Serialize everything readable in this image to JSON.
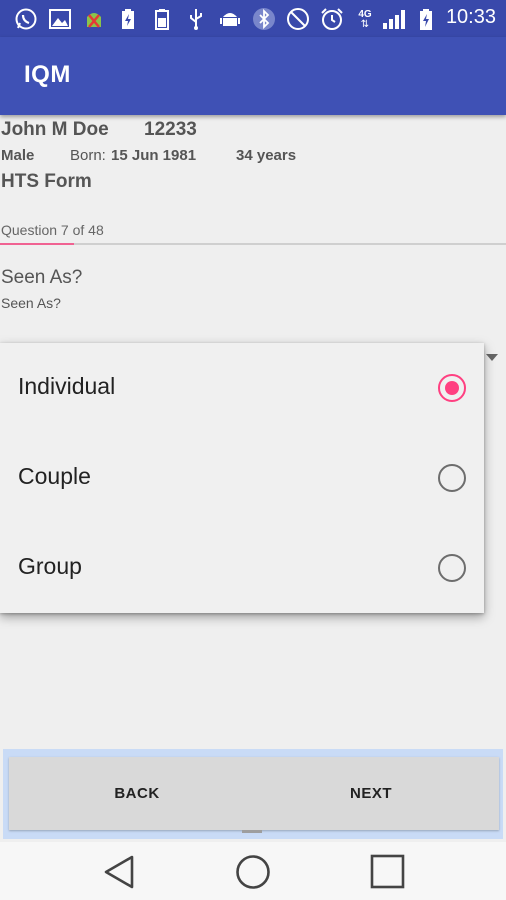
{
  "status_bar": {
    "time": "10:33",
    "icons": [
      "whatsapp-icon",
      "image-icon",
      "android-debug-icon",
      "battery-charging-icon",
      "storage-icon",
      "usb-icon",
      "android-icon",
      "bluetooth-icon",
      "do-not-disturb-icon",
      "alarm-icon",
      "4g-icon",
      "signal-icon",
      "battery-icon"
    ],
    "network_label": "4G"
  },
  "app_bar": {
    "title": "IQM"
  },
  "patient": {
    "name": "John M Doe",
    "id": "12233",
    "gender": "Male",
    "born_label": "Born:",
    "born_date": "15 Jun 1981",
    "age": "34 years"
  },
  "form": {
    "name": "HTS Form"
  },
  "progress": {
    "text": "Question 7 of 48",
    "current": 7,
    "total": 48
  },
  "question": {
    "title": "Seen As?",
    "subtitle": "Seen As?"
  },
  "dropdown": {
    "options": [
      {
        "label": "Individual",
        "selected": true
      },
      {
        "label": "Couple",
        "selected": false
      },
      {
        "label": "Group",
        "selected": false
      }
    ]
  },
  "buttons": {
    "back": "BACK",
    "next": "NEXT"
  },
  "nav": {
    "icons": [
      "back-triangle-icon",
      "home-circle-icon",
      "recents-square-icon"
    ]
  },
  "colors": {
    "app_bar": "#3f51b5",
    "status_bar": "#3949ab",
    "accent": "#ff4081",
    "progress": "#f06292"
  }
}
